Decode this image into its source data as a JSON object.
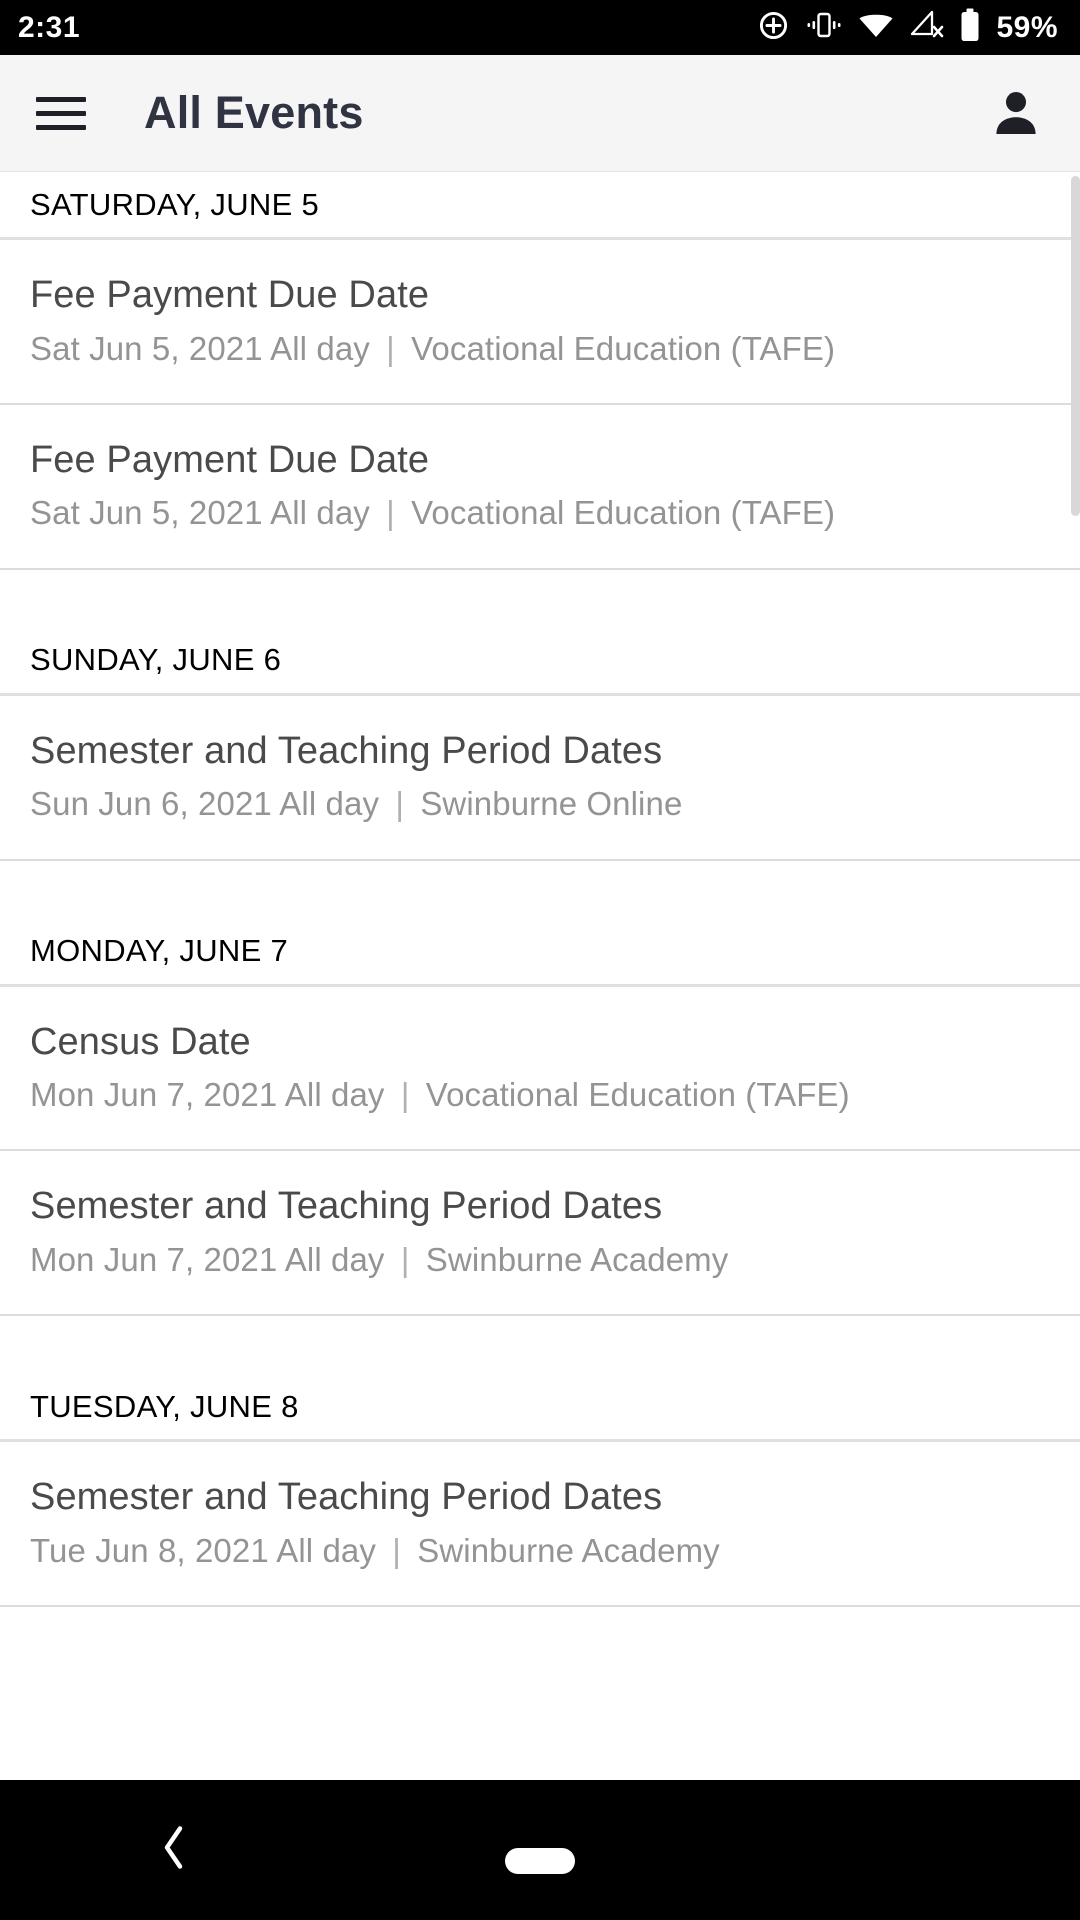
{
  "status_bar": {
    "time": "2:31",
    "battery_percent": "59%",
    "icons": [
      "location-icon",
      "vibrate-icon",
      "wifi-icon",
      "cellular-off-icon",
      "battery-icon"
    ]
  },
  "app_bar": {
    "menu_icon": "hamburger-menu-icon",
    "title": "All Events",
    "account_icon": "person-account-icon"
  },
  "sections": [
    {
      "date_label": "SATURDAY, JUNE 5",
      "events": [
        {
          "title": "Fee Payment Due Date",
          "when": "Sat Jun 5, 2021 All day",
          "separator": "|",
          "category": "Vocational Education (TAFE)"
        },
        {
          "title": "Fee Payment Due Date",
          "when": "Sat Jun 5, 2021 All day",
          "separator": "|",
          "category": "Vocational Education (TAFE)"
        }
      ]
    },
    {
      "date_label": "SUNDAY, JUNE 6",
      "events": [
        {
          "title": "Semester and Teaching Period Dates",
          "when": "Sun Jun 6, 2021 All day",
          "separator": "|",
          "category": "Swinburne Online"
        }
      ]
    },
    {
      "date_label": "MONDAY, JUNE 7",
      "events": [
        {
          "title": "Census Date",
          "when": "Mon Jun 7, 2021 All day",
          "separator": "|",
          "category": "Vocational Education (TAFE)"
        },
        {
          "title": "Semester and Teaching Period Dates",
          "when": "Mon Jun 7, 2021 All day",
          "separator": "|",
          "category": "Swinburne Academy"
        }
      ]
    },
    {
      "date_label": "TUESDAY, JUNE 8",
      "events": [
        {
          "title": "Semester and Teaching Period Dates",
          "when": "Tue Jun 8, 2021 All day",
          "separator": "|",
          "category": "Swinburne Academy"
        }
      ]
    }
  ],
  "nav_bar": {
    "back_icon": "back-chevron-icon",
    "home_icon": "home-pill-icon"
  },
  "colors": {
    "status_bar_bg": "#000000",
    "app_bar_bg": "#f5f5f5",
    "title_color": "#2f3342",
    "event_title_color": "#4a4a4a",
    "event_sub_color": "#949494",
    "divider": "#dcdcdc",
    "nav_bar_bg": "#000000"
  }
}
